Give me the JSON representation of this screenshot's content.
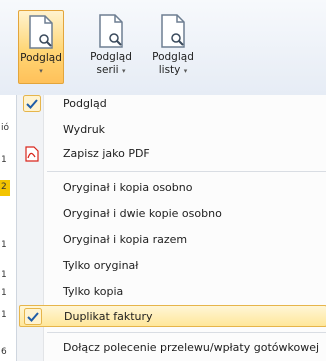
{
  "toolbar": {
    "buttons": [
      {
        "line1": "Podgląd",
        "line2": "",
        "arrow": "▾",
        "active": true
      },
      {
        "line1": "Podgląd",
        "line2": "serii",
        "arrow": "▾",
        "active": false
      },
      {
        "line1": "Podgląd",
        "line2": "listy",
        "arrow": "▾",
        "active": false
      }
    ]
  },
  "left_strip": [
    "ió",
    "1",
    "2",
    "1",
    "1",
    "1",
    "1",
    "6"
  ],
  "menu": {
    "items": [
      {
        "label": "Podgląd",
        "checked": true
      },
      {
        "label": "Wydruk",
        "checked": false
      },
      {
        "label": "Zapisz jako PDF",
        "icon": "pdf-icon"
      },
      {
        "label": "Oryginał i kopia osobno"
      },
      {
        "label": "Oryginał i dwie kopie osobno"
      },
      {
        "label": "Oryginał i kopia razem"
      },
      {
        "label": "Tylko oryginał"
      },
      {
        "label": "Tylko kopia"
      },
      {
        "label": "Duplikat faktury",
        "checked": true,
        "highlighted": true
      },
      {
        "label": "Dołącz polecenie przelewu/wpłaty gotówkowej"
      }
    ]
  },
  "colors": {
    "accent": "#ffc15a",
    "check": "#2f6fb7",
    "pdf": "#d9261c"
  }
}
